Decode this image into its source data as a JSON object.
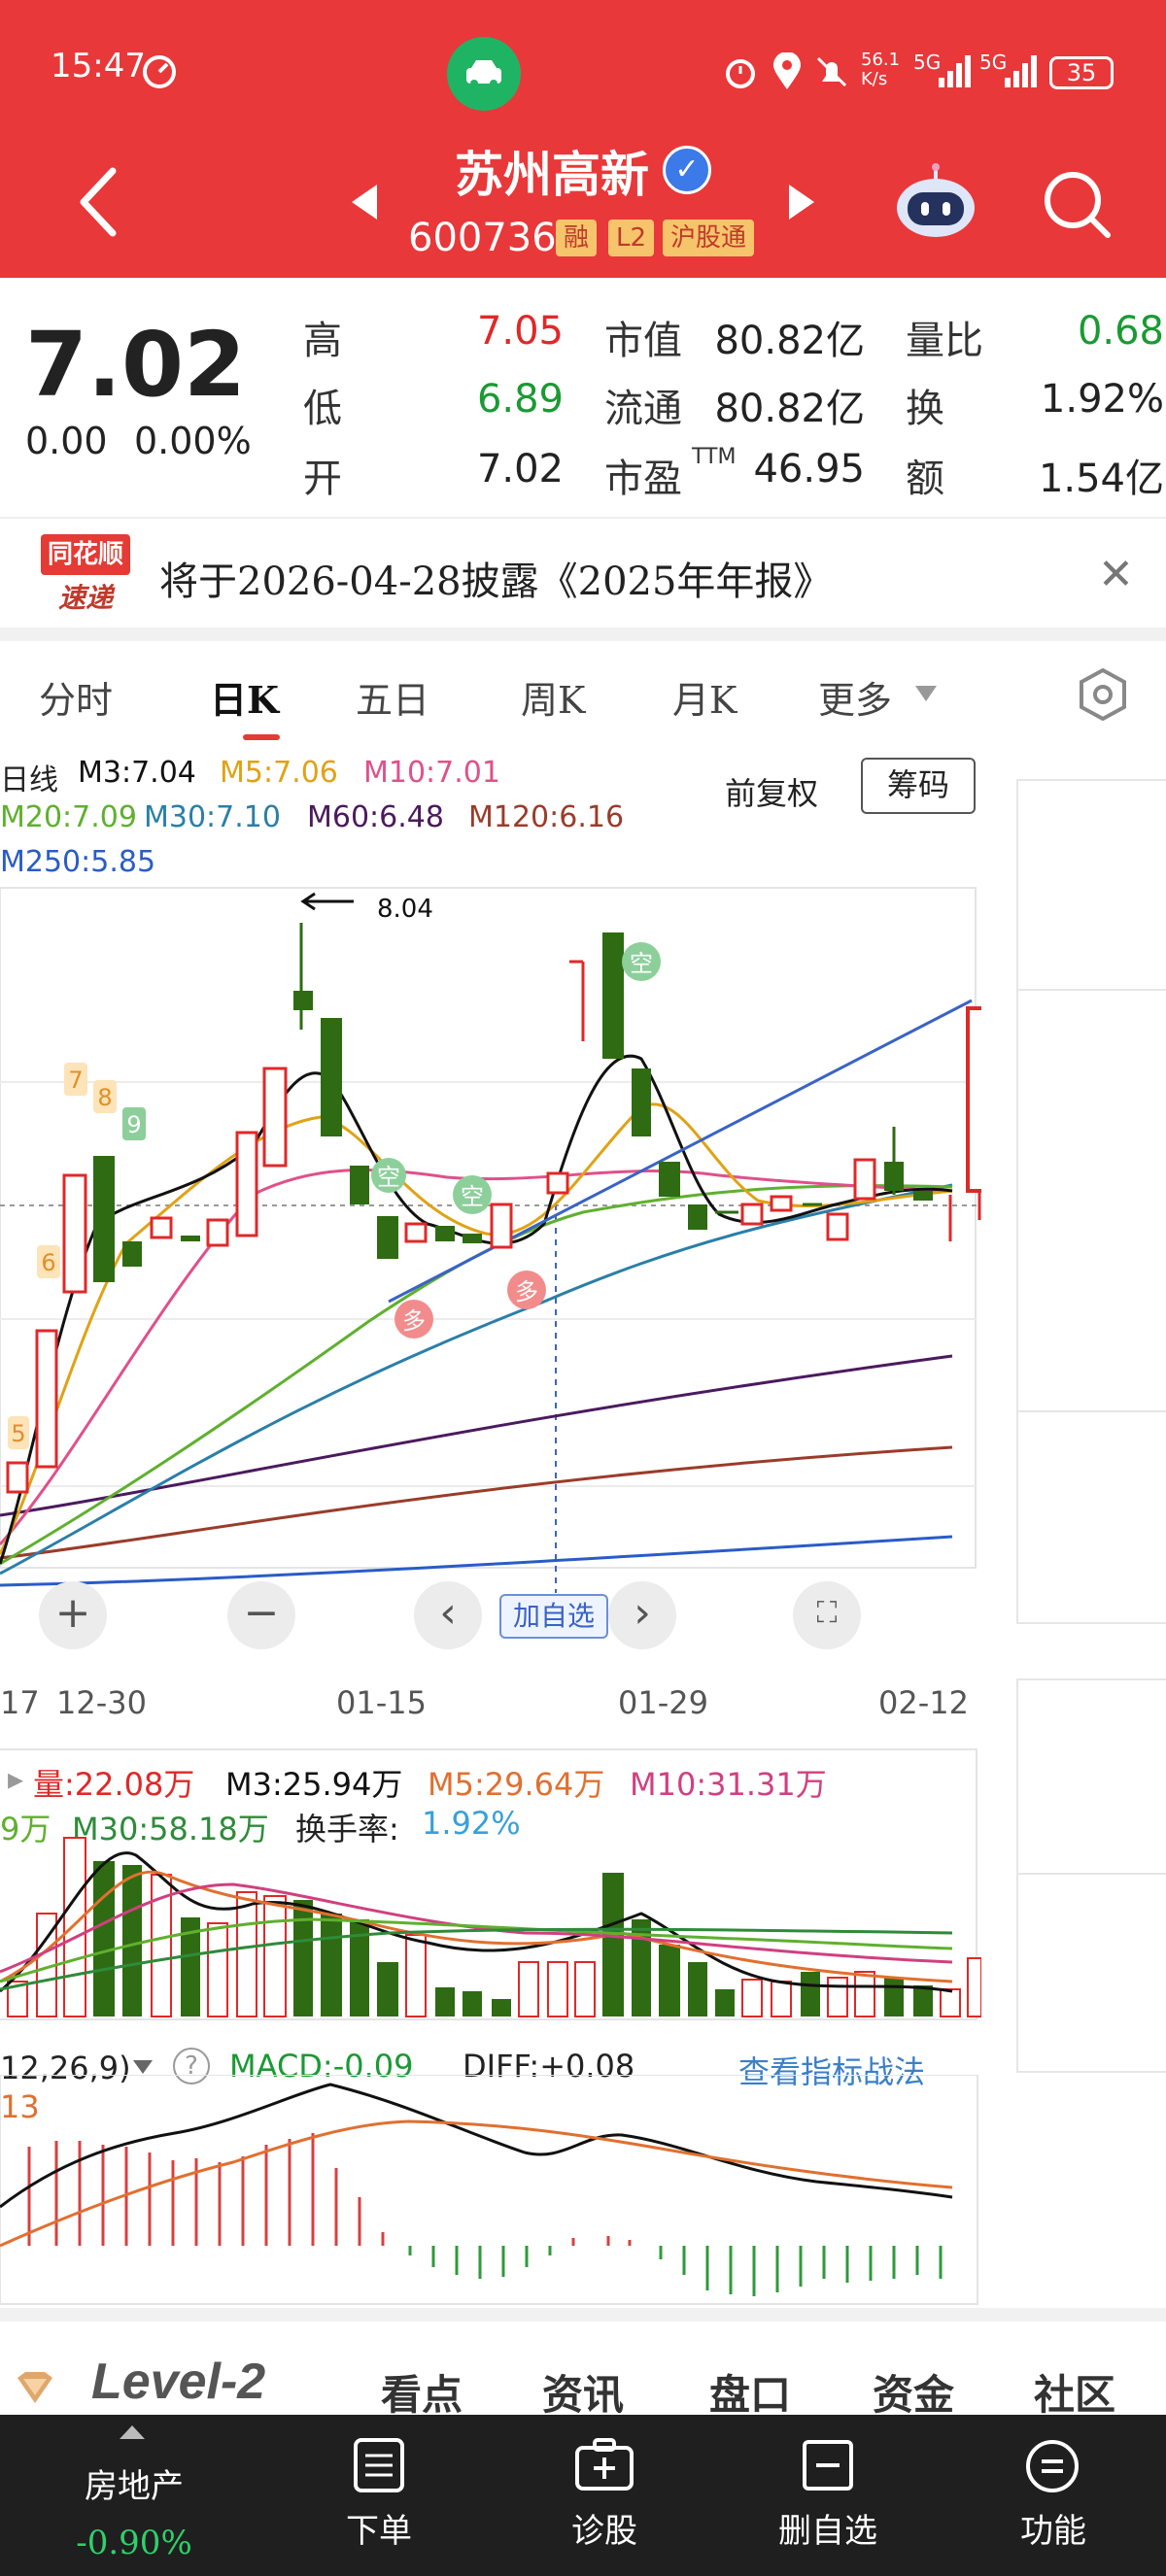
{
  "status": {
    "time": "15:47",
    "net_speed": "56.1\nK/s",
    "battery": "35",
    "signal1": "5G",
    "signal2": "5G"
  },
  "stock": {
    "name": "苏州高新",
    "code": "600736",
    "tags": [
      "融",
      "L2",
      "沪股通"
    ],
    "price": "7.02",
    "change": "0.00",
    "change_pct": "0.00%",
    "quote": [
      {
        "label": "高",
        "value": "7.05"
      },
      {
        "label": "低",
        "value": "6.89"
      },
      {
        "label": "开",
        "value": "7.02"
      },
      {
        "label": "市值",
        "value": "80.82亿"
      },
      {
        "label": "流通",
        "value": "80.82亿"
      },
      {
        "label": "市盈",
        "sup": "TTM",
        "value": "46.95"
      },
      {
        "label": "量比",
        "value": "0.68"
      },
      {
        "label": "换",
        "value": "1.92%"
      },
      {
        "label": "额",
        "value": "1.54亿"
      }
    ]
  },
  "notice": {
    "logo_top": "同花顺",
    "logo_bottom": "速递",
    "text": "将于2026-04-28披露《2025年年报》"
  },
  "tabs": [
    "分时",
    "日K",
    "五日",
    "周K",
    "月K",
    "更多"
  ],
  "ma": {
    "period": "日线",
    "m3": "M3:7.04",
    "m5": "M5:7.06",
    "m10": "M10:7.01",
    "m20": "M20:7.09",
    "m30": "M30:7.10",
    "m60": "M60:6.48",
    "m120": "M120:6.16",
    "m250": "M250:5.85",
    "adjust": "前复权",
    "chips": "筹码"
  },
  "chart_data": {
    "type": "candlestick",
    "x_ticks": [
      "17",
      "12-30",
      "01-15",
      "01-29",
      "02-12"
    ],
    "high_annotation": "8.04",
    "signals": [
      "空",
      "空",
      "空",
      "多",
      "多"
    ],
    "labels": [
      "5",
      "6",
      "7",
      "8",
      "9"
    ]
  },
  "chart_controls": {
    "zoom_in": "+",
    "zoom_out": "−",
    "prev": "‹",
    "next": "›",
    "add_watch": "加自选"
  },
  "volume": {
    "vol": "量:22.08万",
    "m3": "M3:25.94万",
    "m5": "M5:29.64万",
    "m10": "M10:31.31万",
    "m20_tail": "9万",
    "m30": "M30:58.18万",
    "turnover_label": "换手率:",
    "turnover": "1.92%"
  },
  "macd": {
    "params": "12,26,9)",
    "macd": "MACD:-0.09",
    "diff": "DIFF:+0.08",
    "link": "查看指标战法",
    "side_value": "13"
  },
  "bottom_tabs": [
    "Level-2",
    "看点",
    "资讯",
    "盘口",
    "资金",
    "社区"
  ],
  "nav": {
    "sector": "房地产",
    "sector_change": "-0.90%",
    "items": [
      "下单",
      "诊股",
      "删自选",
      "功能"
    ]
  },
  "colors": {
    "header": "#e8383a",
    "up": "#e02828",
    "down": "#1a9a33",
    "nav": "#1f1f1f"
  }
}
